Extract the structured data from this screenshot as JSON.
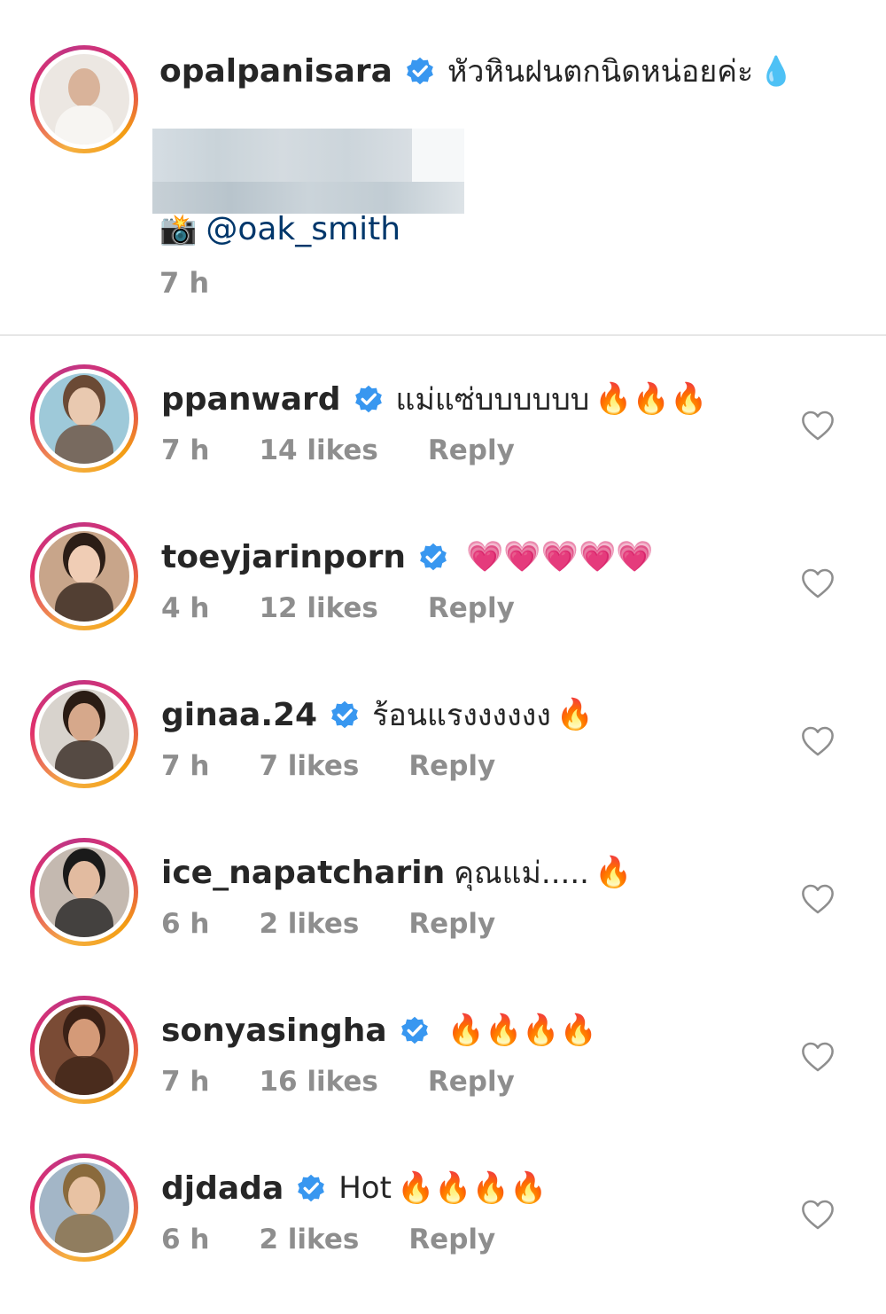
{
  "post": {
    "username": "opalpanisara",
    "caption": "หัวหินฝนตกนิดหน่อยค่ะ",
    "caption_emoji": "💧",
    "credit_emoji": "📸",
    "credit_mention": "@oak_smith",
    "time": "7 h"
  },
  "comments": [
    {
      "username": "ppanward",
      "verified": true,
      "text": "แม่แซ่บบบบบบ",
      "emoji": "🔥🔥🔥",
      "time": "7 h",
      "likes": "14 likes",
      "reply": "Reply",
      "avatar_color": "#9ec9d9",
      "skin": "#e9c9b0",
      "hair": "#6b4a35"
    },
    {
      "username": "toeyjarinporn",
      "verified": true,
      "text": "",
      "emoji": "💗💗💗💗💗",
      "time": "4 h",
      "likes": "12 likes",
      "reply": "Reply",
      "avatar_color": "#c8a58a",
      "skin": "#f0cdb5",
      "hair": "#2b1d16"
    },
    {
      "username": "ginaa.24",
      "verified": true,
      "text": "ร้อนแรงงงงงง",
      "emoji": "🔥",
      "time": "7 h",
      "likes": "7 likes",
      "reply": "Reply",
      "avatar_color": "#d8d3cd",
      "skin": "#d6a88b",
      "hair": "#2a1c14"
    },
    {
      "username": "ice_napatcharin",
      "verified": false,
      "text": "คุณแม่.....",
      "emoji": "🔥",
      "time": "6 h",
      "likes": "2 likes",
      "reply": "Reply",
      "avatar_color": "#c4b9b0",
      "skin": "#e2bba0",
      "hair": "#1a1a1a"
    },
    {
      "username": "sonyasingha",
      "verified": true,
      "text": "",
      "emoji": "🔥🔥🔥🔥",
      "time": "7 h",
      "likes": "16 likes",
      "reply": "Reply",
      "avatar_color": "#7a4b35",
      "skin": "#d49a78",
      "hair": "#3b2116"
    },
    {
      "username": "djdada",
      "verified": true,
      "text": "Hot",
      "emoji": "🔥🔥🔥🔥",
      "time": "6 h",
      "likes": "2 likes",
      "reply": "Reply",
      "avatar_color": "#a3b6c7",
      "skin": "#e8c2a3",
      "hair": "#8a6a3c"
    }
  ],
  "colors": {
    "verified": "#3897f0",
    "meta": "#8e8e8e",
    "mention": "#00376b",
    "ring_start": "#f5b041",
    "ring_end": "#e1306c"
  },
  "icons": {
    "verified": "verified-badge-icon",
    "like": "heart-outline-icon"
  }
}
